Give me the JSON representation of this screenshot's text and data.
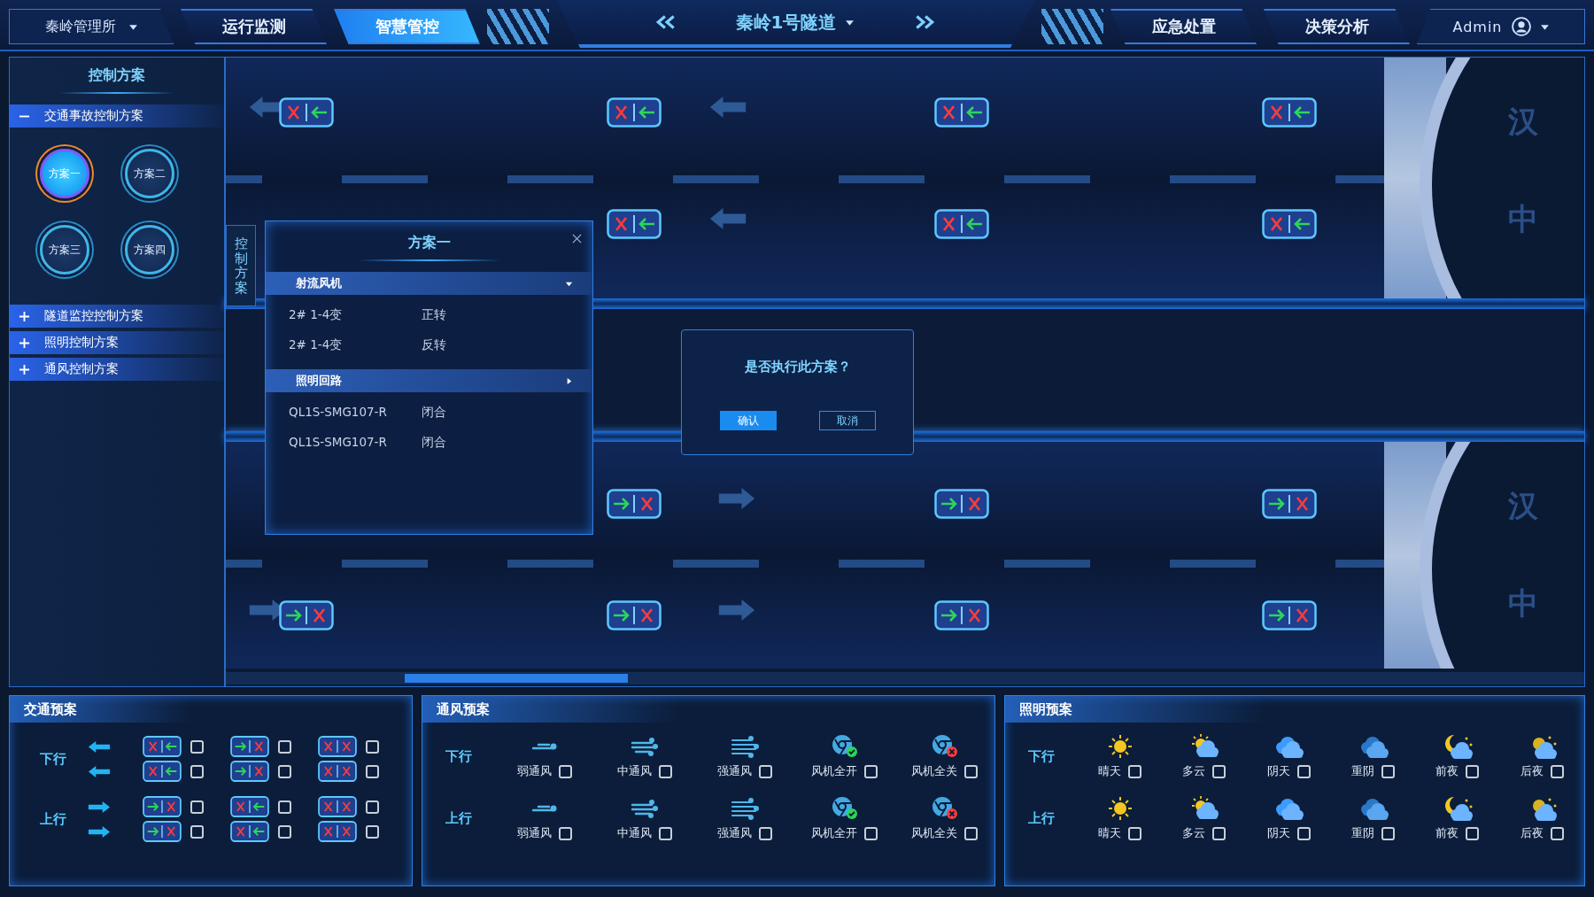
{
  "header": {
    "site": "秦岭管理所",
    "tabs_left": [
      {
        "label": "运行监测",
        "selected": false
      },
      {
        "label": "智慧管控",
        "selected": true
      }
    ],
    "tunnel": "秦岭1号隧道",
    "tabs_right": [
      {
        "label": "应急处置",
        "selected": false
      },
      {
        "label": "决策分析",
        "selected": false
      }
    ],
    "user": "Admin"
  },
  "sidebar": {
    "title": "控制方案",
    "groups": [
      {
        "label": "交通事故控制方案",
        "expanded": true,
        "plans": [
          {
            "label": "方案一",
            "selected": true
          },
          {
            "label": "方案二",
            "selected": false
          },
          {
            "label": "方案三",
            "selected": false
          },
          {
            "label": "方案四",
            "selected": false
          }
        ]
      },
      {
        "label": "隧道监控控制方案",
        "expanded": false
      },
      {
        "label": "照明控制方案",
        "expanded": false
      },
      {
        "label": "通风控制方案",
        "expanded": false
      }
    ]
  },
  "side_tab": "控制方案",
  "map": {
    "upper_portal": [
      "汉",
      "中"
    ],
    "lower_portal": [
      "汉",
      "中"
    ],
    "upper_tunnel": [
      [
        {
          "kind": "x-left"
        },
        {
          "kind": "x-left"
        },
        {
          "kind": "x-left"
        },
        {
          "kind": "x-left"
        }
      ],
      [
        {
          "kind": "x-left"
        },
        {
          "kind": "x-left"
        },
        {
          "kind": "x-left"
        }
      ]
    ],
    "lower_tunnel": [
      [
        {
          "kind": "right-x"
        },
        {
          "kind": "right-x"
        },
        {
          "kind": "right-x"
        }
      ],
      [
        {
          "kind": "right-x"
        },
        {
          "kind": "right-x"
        },
        {
          "kind": "right-x"
        },
        {
          "kind": "right-x"
        }
      ]
    ]
  },
  "plan_popup": {
    "title": "方案一",
    "sections": [
      {
        "title": "射流风机",
        "expanded": true,
        "rows": [
          {
            "device": "2# 1-4变",
            "action": "正转"
          },
          {
            "device": "2# 1-4变",
            "action": "反转"
          }
        ]
      },
      {
        "title": "照明回路",
        "expanded": false,
        "rows": [
          {
            "device": "QL1S-SMG107-R",
            "action": "闭合"
          },
          {
            "device": "QL1S-SMG107-R",
            "action": "闭合"
          }
        ]
      }
    ]
  },
  "confirm": {
    "message": "是否执行此方案？",
    "buttons": [
      {
        "label": "确认",
        "kind": "primary"
      },
      {
        "label": "取消",
        "kind": "secondary"
      }
    ]
  },
  "traffic_plan": {
    "title": "交通预案",
    "groups": [
      {
        "direction": "下行",
        "rows": [
          {
            "kind": "left",
            "options": [
              {
                "kind": "x-left",
                "checked": false
              },
              {
                "kind": "right-x",
                "checked": false
              },
              {
                "kind": "x-x",
                "checked": false
              }
            ]
          },
          {
            "kind": "left",
            "options": [
              {
                "kind": "x-left",
                "checked": false
              },
              {
                "kind": "right-x",
                "checked": false
              },
              {
                "kind": "x-x",
                "checked": false
              }
            ]
          }
        ]
      },
      {
        "direction": "上行",
        "rows": [
          {
            "kind": "right",
            "options": [
              {
                "kind": "right-x",
                "checked": false
              },
              {
                "kind": "x-left",
                "checked": false
              },
              {
                "kind": "x-x",
                "checked": false
              }
            ]
          },
          {
            "kind": "right",
            "options": [
              {
                "kind": "right-x",
                "checked": false
              },
              {
                "kind": "x-left",
                "checked": false
              },
              {
                "kind": "x-x",
                "checked": false
              }
            ]
          }
        ]
      }
    ]
  },
  "ventilation_plan": {
    "title": "通风预案",
    "groups": [
      {
        "direction": "下行",
        "options": [
          {
            "kind": "weak",
            "label": "弱通风",
            "checked": false
          },
          {
            "kind": "medium",
            "label": "中通风",
            "checked": false
          },
          {
            "kind": "strong",
            "label": "强通风",
            "checked": false
          },
          {
            "kind": "all-on",
            "label": "风机全开",
            "checked": false
          },
          {
            "kind": "all-off",
            "label": "风机全关",
            "checked": false
          }
        ]
      },
      {
        "direction": "上行",
        "options": [
          {
            "kind": "weak",
            "label": "弱通风",
            "checked": false
          },
          {
            "kind": "medium",
            "label": "中通风",
            "checked": false
          },
          {
            "kind": "strong",
            "label": "强通风",
            "checked": false
          },
          {
            "kind": "all-on",
            "label": "风机全开",
            "checked": false
          },
          {
            "kind": "all-off",
            "label": "风机全关",
            "checked": false
          }
        ]
      }
    ]
  },
  "lighting_plan": {
    "title": "照明预案",
    "groups": [
      {
        "direction": "下行",
        "options": [
          {
            "kind": "sunny",
            "label": "晴天",
            "checked": false
          },
          {
            "kind": "partly-cloudy",
            "label": "多云",
            "checked": false
          },
          {
            "kind": "overcast",
            "label": "阴天",
            "checked": false
          },
          {
            "kind": "heavy-overcast",
            "label": "重阴",
            "checked": false
          },
          {
            "kind": "early-night",
            "label": "前夜",
            "checked": false
          },
          {
            "kind": "late-night",
            "label": "后夜",
            "checked": false
          }
        ]
      },
      {
        "direction": "上行",
        "options": [
          {
            "kind": "sunny",
            "label": "晴天",
            "checked": false
          },
          {
            "kind": "partly-cloudy",
            "label": "多云",
            "checked": false
          },
          {
            "kind": "overcast",
            "label": "阴天",
            "checked": false
          },
          {
            "kind": "heavy-overcast",
            "label": "重阴",
            "checked": false
          },
          {
            "kind": "early-night",
            "label": "前夜",
            "checked": false
          },
          {
            "kind": "late-night",
            "label": "后夜",
            "checked": false
          }
        ]
      }
    ]
  }
}
